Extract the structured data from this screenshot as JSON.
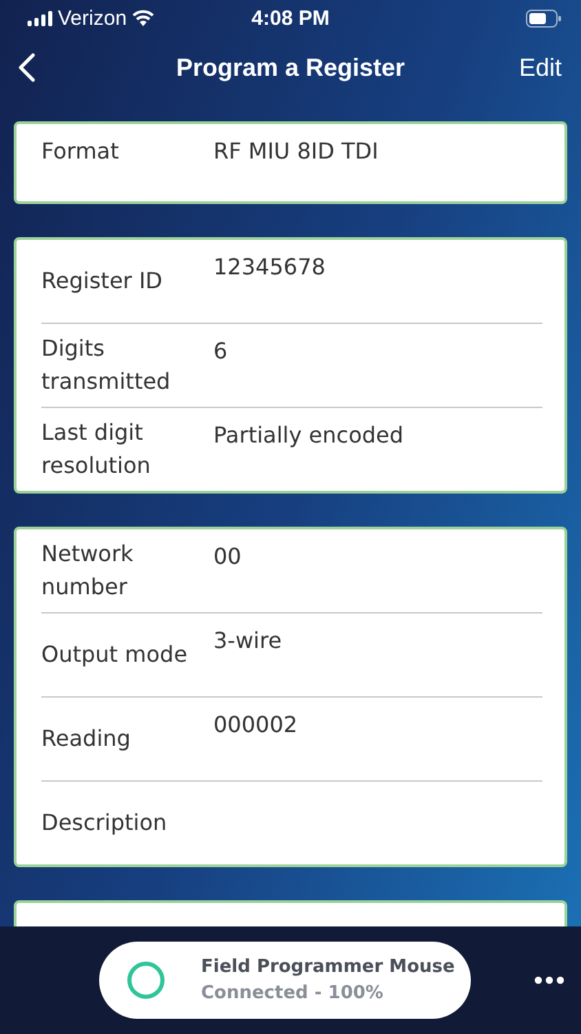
{
  "status_bar": {
    "carrier": "Verizon",
    "time": "4:08 PM"
  },
  "nav": {
    "title": "Program a Register",
    "action": "Edit"
  },
  "cards": [
    {
      "rows": [
        {
          "label": "Format",
          "value": "RF MIU 8ID TDI"
        }
      ]
    },
    {
      "rows": [
        {
          "label": "Register ID",
          "value": "12345678"
        },
        {
          "label": "Digits transmitted",
          "value": "6"
        },
        {
          "label": "Last digit resolution",
          "value": "Partially encoded"
        }
      ]
    },
    {
      "rows": [
        {
          "label": "Network number",
          "value": "00"
        },
        {
          "label": "Output mode",
          "value": "3-wire"
        },
        {
          "label": "Reading",
          "value": "000002"
        },
        {
          "label": "Description"
        }
      ]
    }
  ],
  "device": {
    "name": "Field Programmer Mouse",
    "status": "Connected - 100%"
  }
}
